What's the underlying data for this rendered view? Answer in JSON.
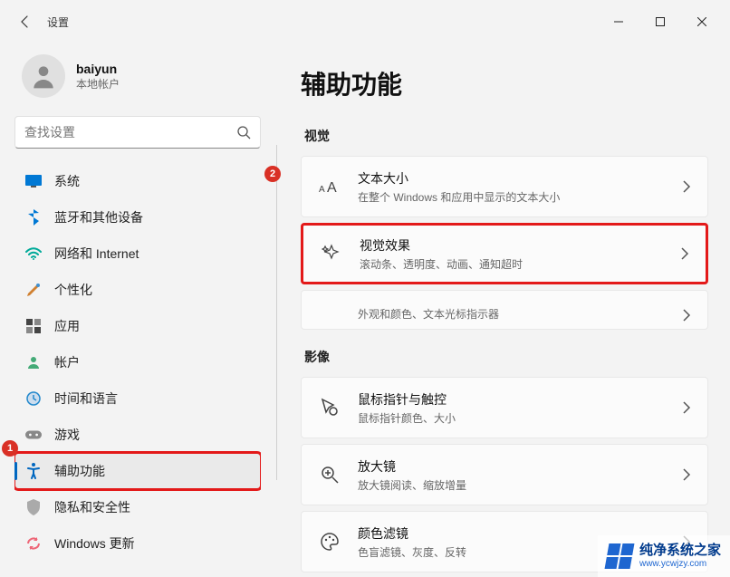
{
  "app_title": "设置",
  "user": {
    "name": "baiyun",
    "sub": "本地帐户"
  },
  "search": {
    "placeholder": "查找设置"
  },
  "nav": {
    "items": [
      {
        "label": "系统"
      },
      {
        "label": "蓝牙和其他设备"
      },
      {
        "label": "网络和 Internet"
      },
      {
        "label": "个性化"
      },
      {
        "label": "应用"
      },
      {
        "label": "帐户"
      },
      {
        "label": "时间和语言"
      },
      {
        "label": "游戏"
      },
      {
        "label": "辅助功能"
      },
      {
        "label": "隐私和安全性"
      },
      {
        "label": "Windows 更新"
      }
    ]
  },
  "page": {
    "title": "辅助功能",
    "sections": {
      "visual": {
        "title": "视觉",
        "cards": [
          {
            "title": "文本大小",
            "sub": "在整个 Windows 和应用中显示的文本大小"
          },
          {
            "title": "视觉效果",
            "sub": "滚动条、透明度、动画、通知超时"
          },
          {
            "title": "",
            "sub": "外观和颜色、文本光标指示器"
          }
        ]
      },
      "video": {
        "title": "影像",
        "cards": [
          {
            "title": "鼠标指针与触控",
            "sub": "鼠标指针颜色、大小"
          },
          {
            "title": "放大镜",
            "sub": "放大镜阅读、缩放增量"
          },
          {
            "title": "颜色滤镜",
            "sub": "色盲滤镜、灰度、反转"
          }
        ]
      }
    }
  },
  "annotations": {
    "badge1": "1",
    "badge2": "2"
  },
  "watermark": {
    "line1": "纯净系统之家",
    "line2": "www.ycwjzy.com"
  }
}
